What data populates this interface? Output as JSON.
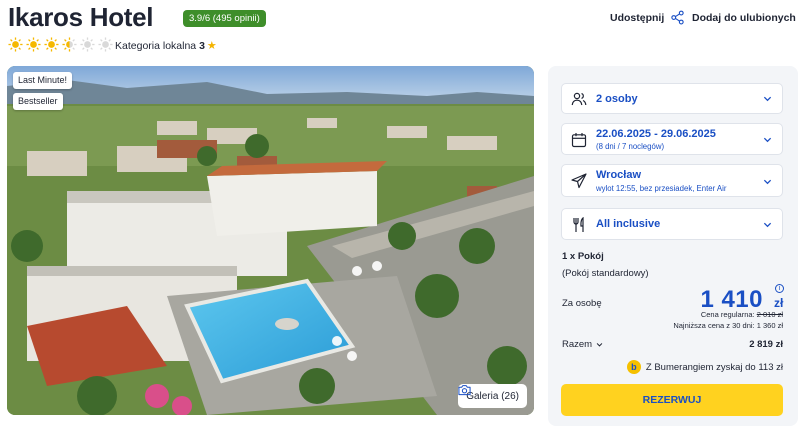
{
  "header": {
    "title": "Ikaros Hotel",
    "rating": "3.9/6 (495 opinii)",
    "suns": {
      "filled": 3.5,
      "total": 5
    },
    "category_label": "Kategoria lokalna",
    "category_value": "3",
    "share_label": "Udostępnij",
    "favorite_label": "Dodaj do ulubionych"
  },
  "photo": {
    "tags": [
      "Last Minute!",
      "Bestseller"
    ],
    "gallery_label": "Galeria (26)"
  },
  "booking": {
    "guests": "2 osoby",
    "dates": "22.06.2025 - 29.06.2025",
    "dates_sub": "(8 dni / 7 noclegów)",
    "departure": "Wrocław",
    "departure_sub": "wylot 12:55, bez przesiadek, Enter Air",
    "board": "All inclusive",
    "room_line1": "1 x Pokój",
    "room_line2": "(Pokój standardowy)",
    "per_person_label": "Za osobę",
    "price": "1 410",
    "currency": "zł",
    "regular_label": "Cena regularna:",
    "regular_price": "2 010 zł",
    "lowest_label": "Najniższa cena z 30 dni: 1 360 zł",
    "total_label": "Razem",
    "total_value": "2 819 zł",
    "bumerang_text": "Z Bumerangiem zyskaj do 113 zł",
    "reserve_label": "REZERWUJ"
  },
  "colors": {
    "accent": "#1a4fc4",
    "rating_green": "#3e8e2a",
    "cta_yellow": "#ffd21f",
    "sun": "#f5b800"
  }
}
